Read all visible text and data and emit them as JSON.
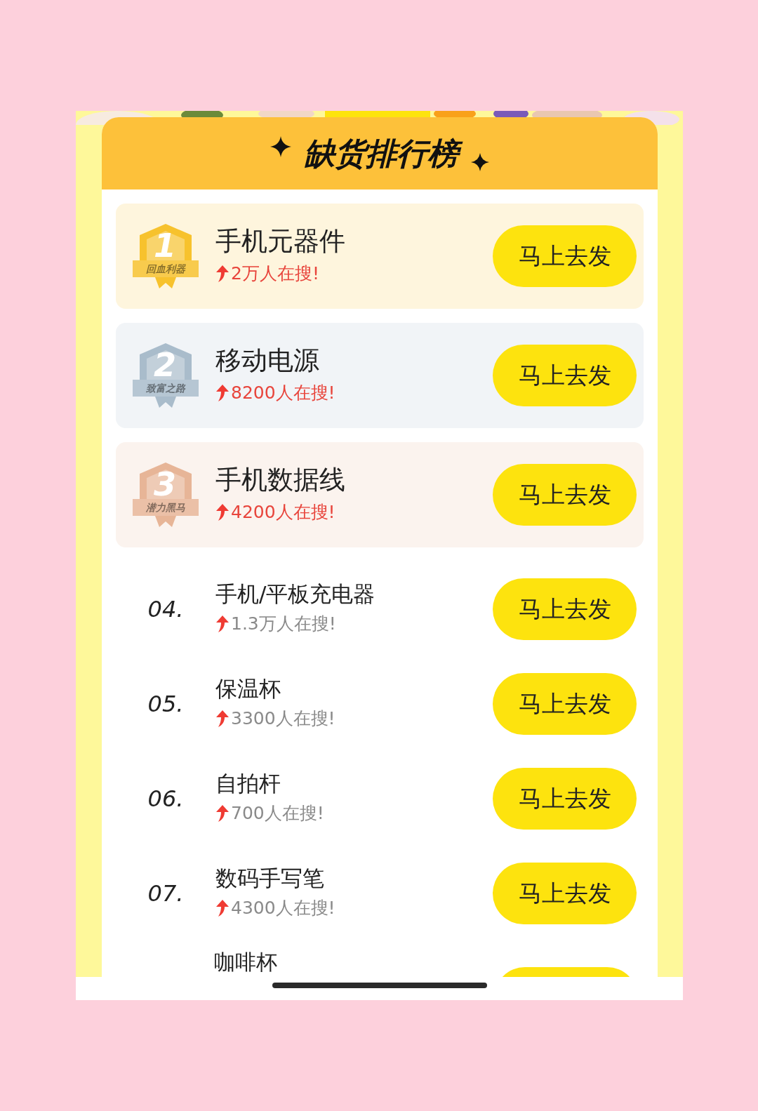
{
  "header": {
    "title": "缺货排行榜"
  },
  "items": [
    {
      "kind": "medal",
      "color": "#f7c22d",
      "rank": "1",
      "medal_label": "回血利器",
      "name": "手机元器件",
      "searches": "2万人在搜!",
      "button": "马上去发"
    },
    {
      "kind": "medal",
      "color": "#a9bccb",
      "rank": "2",
      "medal_label": "致富之路",
      "name": "移动电源",
      "searches": "8200人在搜!",
      "button": "马上去发"
    },
    {
      "kind": "medal",
      "color": "#e7b597",
      "rank": "3",
      "medal_label": "潜力黑马",
      "name": "手机数据线",
      "searches": "4200人在搜!",
      "button": "马上去发"
    },
    {
      "kind": "plain",
      "rank": "04.",
      "name": "手机/平板充电器",
      "searches": "1.3万人在搜!",
      "button": "马上去发"
    },
    {
      "kind": "plain",
      "rank": "05.",
      "name": "保温杯",
      "searches": "3300人在搜!",
      "button": "马上去发"
    },
    {
      "kind": "plain",
      "rank": "06.",
      "name": "自拍杆",
      "searches": "700人在搜!",
      "button": "马上去发"
    },
    {
      "kind": "plain",
      "rank": "07.",
      "name": "数码手写笔",
      "searches": "4300人在搜!",
      "button": "马上去发"
    },
    {
      "kind": "cut",
      "name": "咖啡杯"
    }
  ]
}
